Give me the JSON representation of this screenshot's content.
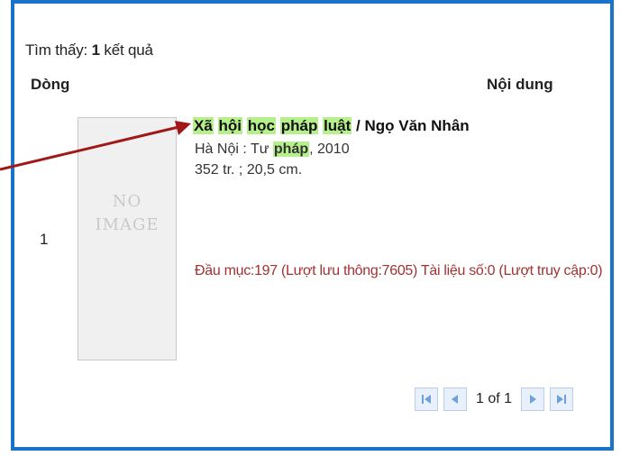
{
  "search": {
    "found_label": "Tìm thấy:",
    "found_count": "1",
    "found_suffix": "kết quả"
  },
  "table": {
    "columns": [
      "Dòng",
      "Nội dung"
    ],
    "rows": [
      {
        "index": "1",
        "thumbnail": {
          "line1": "NO",
          "line2": "IMAGE"
        },
        "title": {
          "w1": "Xã",
          "w2": "hội",
          "w3": "học",
          "w4": "pháp",
          "w5": "luật",
          "sep": " / ",
          "author": "Ngọ Văn Nhân"
        },
        "publication": {
          "prefix": "Hà Nội : Tư ",
          "highlight": "pháp",
          "suffix": ", 2010"
        },
        "physical": "352 tr. ; 20,5 cm.",
        "stats": "Đầu mục:197 (Lượt lưu thông:7605) Tài liệu số:0 (Lượt truy cập:0)"
      }
    ]
  },
  "pager": {
    "info": "1 of 1",
    "icons": [
      "first-page-icon",
      "prev-page-icon",
      "next-page-icon",
      "last-page-icon"
    ]
  },
  "colors": {
    "frame": "#1a73c8",
    "highlight": "#b6f08c",
    "arrow": "#a01818",
    "stats_text": "#a23232"
  }
}
